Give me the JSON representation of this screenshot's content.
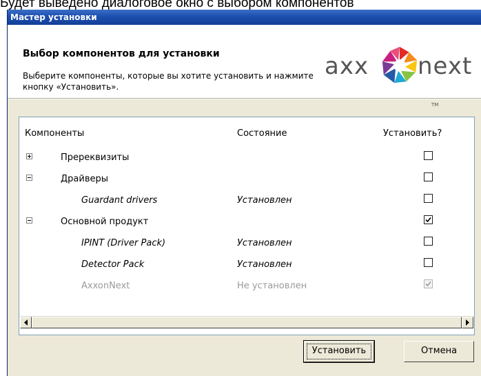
{
  "doc_caption": "Будет выведено диалоговое окно с выбором компонентов",
  "window": {
    "title": "Мастер установки"
  },
  "header": {
    "title": "Выбор компонентов для установки",
    "subtitle": "Выберите компоненты, которые вы хотите установить и нажмите кнопку «Установить».",
    "logo": {
      "text_left": "axx",
      "text_right": "next",
      "tm": "TM"
    }
  },
  "list": {
    "columns": {
      "components": "Компоненты",
      "state": "Состояние",
      "install": "Установить?"
    },
    "rows": [
      {
        "label": "Пререквизиты",
        "state": "",
        "expander": "plus",
        "checked": false,
        "level": 0,
        "disabled": false
      },
      {
        "label": "Драйверы",
        "state": "",
        "expander": "minus",
        "checked": false,
        "level": 0,
        "disabled": false
      },
      {
        "label": "Guardant drivers",
        "state": "Установлен",
        "expander": "",
        "checked": false,
        "level": 1,
        "disabled": false
      },
      {
        "label": "Основной продукт",
        "state": "",
        "expander": "minus",
        "checked": true,
        "level": 0,
        "disabled": false
      },
      {
        "label": "IPINT (Driver Pack)",
        "state": "Установлен",
        "expander": "",
        "checked": false,
        "level": 1,
        "disabled": false
      },
      {
        "label": "Detector Pack",
        "state": "Установлен",
        "expander": "",
        "checked": false,
        "level": 1,
        "disabled": false
      },
      {
        "label": "AxxonNext",
        "state": "Не установлен",
        "expander": "",
        "checked": true,
        "level": 1,
        "disabled": true
      }
    ]
  },
  "buttons": {
    "install": "Установить",
    "cancel": "Отмена"
  },
  "colors": {
    "titlebar": "#1d4fae",
    "dialog_bg": "#ece9d8",
    "list_border": "#7f9db9"
  }
}
